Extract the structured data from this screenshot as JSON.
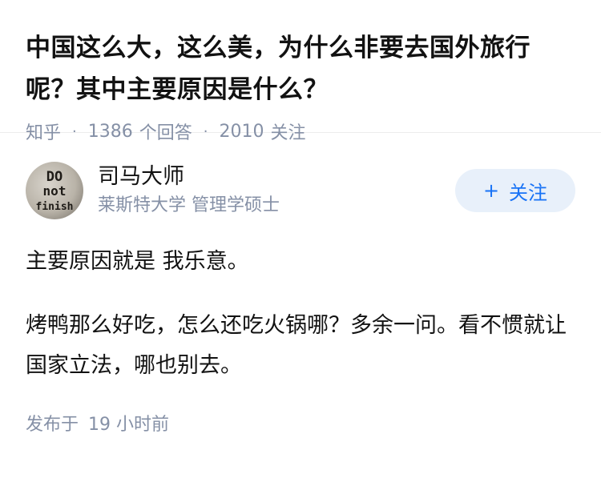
{
  "question": {
    "title": "中国这么大，这么美，为什么非要去国外旅行呢？其中主要原因是什么？",
    "source": "知乎",
    "answer_count": "1386",
    "answer_label": "个回答",
    "follow_count": "2010",
    "follow_label": "关注"
  },
  "author": {
    "name": "司马大师",
    "headline": "莱斯特大学 管理学硕士",
    "avatar_text": [
      "DO",
      "not",
      "finish"
    ],
    "follow_button": "+ 关注",
    "follow_plus": "+",
    "follow_text": "关注"
  },
  "answer": {
    "paragraphs": [
      "主要原因就是 我乐意。",
      "烤鸭那么好吃，怎么还吃火锅哪？多余一问。看不惯就让国家立法，哪也别去。"
    ],
    "published_label": "发布于",
    "published_time": "19 小时前"
  },
  "colors": {
    "meta_gray": "#8590a6",
    "accent_blue": "#1772f6",
    "button_bg": "#e8f0fa"
  }
}
